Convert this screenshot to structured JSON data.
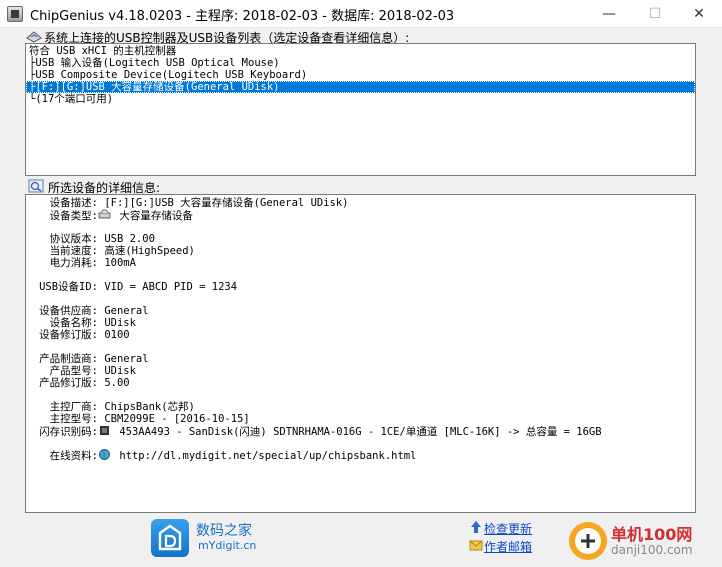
{
  "window": {
    "title": "ChipGenius v4.18.0203 - 主程序: 2018-02-03 - 数据库: 2018-02-03",
    "minimize_glyph": "—",
    "maximize_glyph": "☐",
    "close_glyph": "✕"
  },
  "device_list": {
    "label": "系统上连接的USB控制器及USB设备列表（选定设备查看详细信息）:",
    "items": [
      "符合 USB xHCI 的主机控制器",
      "├USB 输入设备(Logitech USB Optical Mouse)",
      "├USB Composite Device(Logitech USB Keyboard)",
      "├[F:][G:]USB 大容量存储设备(General UDisk)",
      "└(17个端口可用)"
    ],
    "selected_index": 3
  },
  "details": {
    "label": "所选设备的详细信息:",
    "rows": [
      {
        "label": "设备描述:",
        "value": "[F:][G:]USB 大容量存储设备(General UDisk)"
      },
      {
        "label": "设备类型:",
        "value": "大容量存储设备",
        "icon": "drive-icon"
      },
      {
        "label": "",
        "value": ""
      },
      {
        "label": "协议版本:",
        "value": "USB 2.00"
      },
      {
        "label": "当前速度:",
        "value": "高速(HighSpeed)"
      },
      {
        "label": "电力消耗:",
        "value": "100mA"
      },
      {
        "label": "",
        "value": ""
      },
      {
        "label": "USB设备ID:",
        "value": "VID = ABCD PID = 1234"
      },
      {
        "label": "",
        "value": ""
      },
      {
        "label": "设备供应商:",
        "value": "General"
      },
      {
        "label": "设备名称:",
        "value": "UDisk"
      },
      {
        "label": "设备修订版:",
        "value": "0100"
      },
      {
        "label": "",
        "value": ""
      },
      {
        "label": "产品制造商:",
        "value": "General"
      },
      {
        "label": "产品型号:",
        "value": "UDisk"
      },
      {
        "label": "产品修订版:",
        "value": "5.00"
      },
      {
        "label": "",
        "value": ""
      },
      {
        "label": "主控厂商:",
        "value": "ChipsBank(芯邦)"
      },
      {
        "label": "主控型号:",
        "value": "CBM2099E - [2016-10-15]"
      },
      {
        "label": "闪存识别码:",
        "value": "453AA493 - SanDisk(闪迪) SDTNRHAMA-016G - 1CE/单通道 [MLC-16K] -> 总容量 = 16GB",
        "icon": "chip-icon"
      },
      {
        "label": "",
        "value": ""
      },
      {
        "label": "在线资料:",
        "value": "http://dl.mydigit.net/special/up/chipsbank.html",
        "icon": "globe-icon"
      }
    ]
  },
  "footer": {
    "brand_cn": "数码之家",
    "brand_en": "mYdigit.cn",
    "check_update": "检查更新",
    "author_mail": "作者邮箱",
    "watermark_cn": "单机100网",
    "watermark_url": "danji100.com"
  },
  "colors": {
    "selection": "#0078d7",
    "link": "#0a48c8",
    "brand_blue": "#1a6fc7",
    "watermark_red": "#d12f2f"
  }
}
